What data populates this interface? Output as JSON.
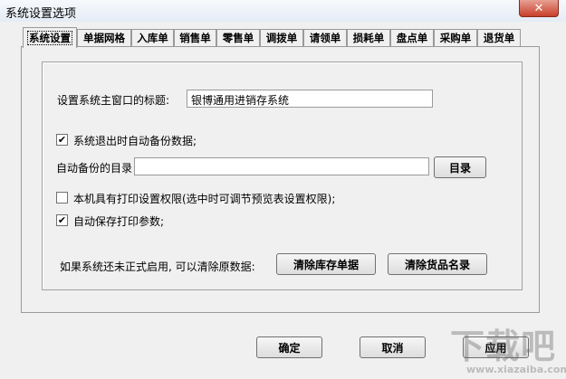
{
  "window": {
    "title": "系统设置选项",
    "close_label": "✕"
  },
  "tabs": [
    {
      "label": "系统设置",
      "active": true
    },
    {
      "label": "单据网格"
    },
    {
      "label": "入库单"
    },
    {
      "label": "销售单"
    },
    {
      "label": "零售单"
    },
    {
      "label": "调拨单"
    },
    {
      "label": "请领单"
    },
    {
      "label": "损耗单"
    },
    {
      "label": "盘点单"
    },
    {
      "label": "采购单"
    },
    {
      "label": "退货单"
    }
  ],
  "settings": {
    "title_label": "设置系统主窗口的标题:",
    "title_value": "银博通用进销存系统",
    "auto_backup": {
      "label": "系统退出时自动备份数据;",
      "checked": true
    },
    "backup_dir_label": "自动备份的目录",
    "backup_dir_value": "",
    "browse_button": "目录",
    "print_permission": {
      "label": "本机具有打印设置权限(选中时可调节预览表设置权限);",
      "checked": false
    },
    "auto_save_print": {
      "label": "自动保存打印参数;",
      "checked": true
    },
    "clear_prompt": "如果系统还未正式启用, 可以清除原数据:",
    "clear_stock_button": "清除库存单据",
    "clear_goods_button": "清除货品名录"
  },
  "footer": {
    "ok_button": "确定",
    "cancel_button": "取消",
    "apply_button": "应用"
  },
  "watermark": {
    "big": "下载吧",
    "small": "www.xiazaiba.com"
  }
}
